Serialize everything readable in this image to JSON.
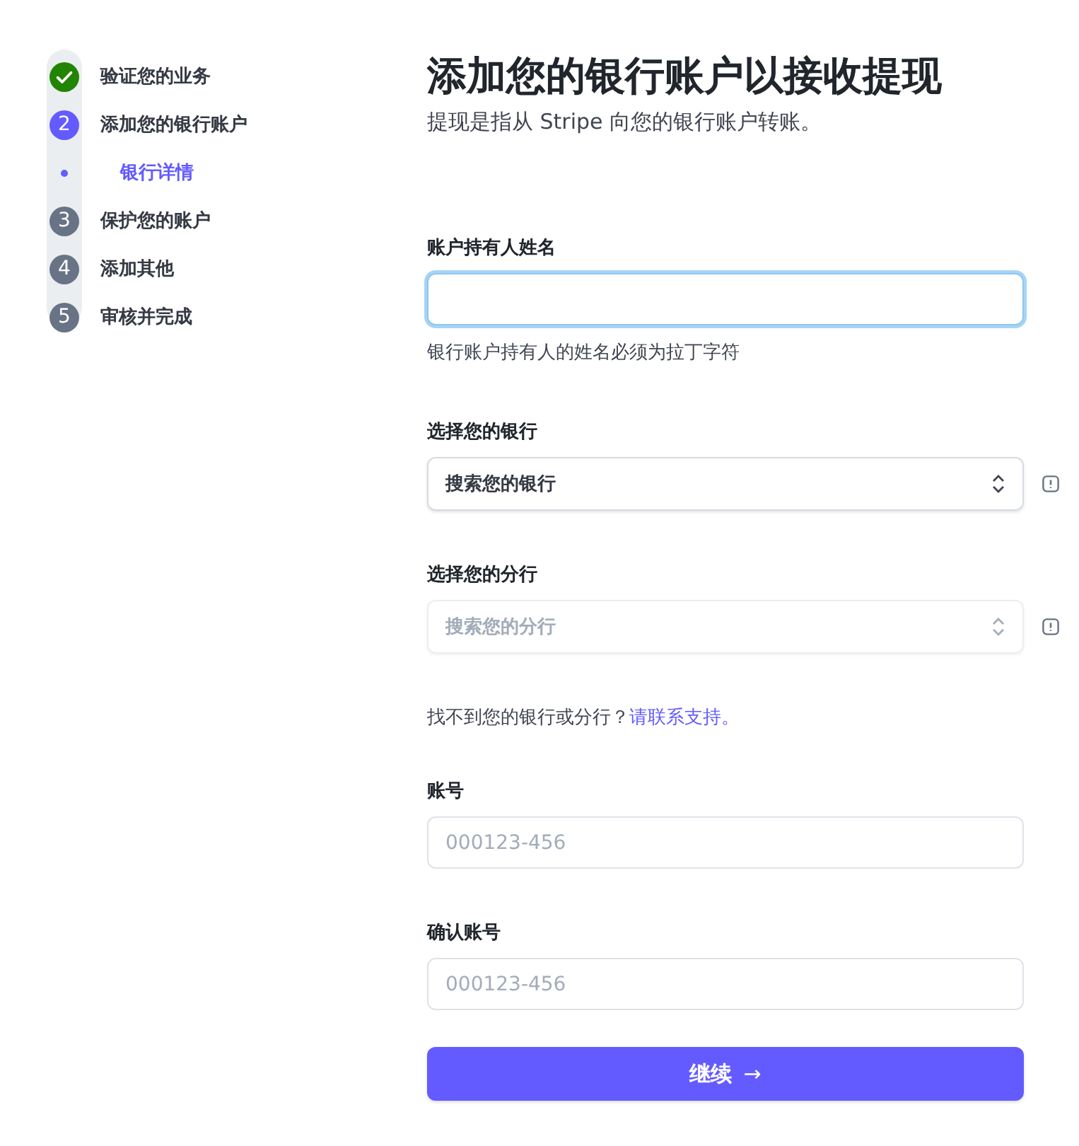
{
  "steps": [
    {
      "label": "验证您的业务",
      "kind": "complete"
    },
    {
      "number": "2",
      "label": "添加您的银行账户",
      "kind": "current",
      "children": [
        {
          "label": "银行详情",
          "selected": true
        }
      ]
    },
    {
      "number": "3",
      "label": "保护您的账户",
      "kind": "upcoming"
    },
    {
      "number": "4",
      "label": "添加其他",
      "kind": "upcoming"
    },
    {
      "number": "5",
      "label": "审核并完成",
      "kind": "upcoming"
    }
  ],
  "title": "添加您的银行账户以接收提现",
  "subtitle": "提现是指从 Stripe 向您的银行账户转账。",
  "fields": [
    {
      "kind": "text",
      "label": "账户持有人姓名",
      "focused": true,
      "hint": "银行账户持有人的姓名必须为拉丁字符"
    },
    {
      "kind": "select",
      "label": "选择您的银行",
      "placeholder": "搜索您的银行",
      "disabled": false,
      "info": true
    },
    {
      "kind": "select",
      "label": "选择您的分行",
      "placeholder": "搜索您的分行",
      "disabled": true,
      "info": true
    },
    {
      "kind": "help",
      "text": "找不到您的银行或分行？",
      "link": "请联系支持。"
    },
    {
      "kind": "text",
      "label": "账号",
      "placeholder": "000123-456",
      "focused": false
    },
    {
      "kind": "text",
      "label": "确认账号",
      "placeholder": "000123-456",
      "focused": false
    }
  ],
  "button": {
    "label": "继续",
    "arrow": "→"
  }
}
